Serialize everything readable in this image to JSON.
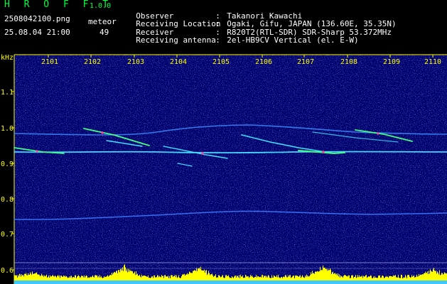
{
  "header": {
    "app_title": "H R O F F T",
    "app_version": "1.0.0",
    "file_name": "2508042100.png",
    "date_time": "25.08.04 21:00",
    "meteor_label": "meteor",
    "meteor_count": "49"
  },
  "info": [
    {
      "key": "Observer",
      "sep": ":",
      "value": "Takanori Kawachi"
    },
    {
      "key": "Receiving Location",
      "sep": ":",
      "value": "Ogaki, Gifu, JAPAN (136.60E, 35.35N)"
    },
    {
      "key": "Receiver",
      "sep": ":",
      "value": "R820T2(RTL-SDR) SDR-Sharp 53.372MHz"
    },
    {
      "key": "Receiving antenna",
      "sep": ":",
      "value": "2el-HB9CV Vertical (el. E-W)"
    }
  ],
  "axes": {
    "y_unit": "kHz",
    "x_ticks": [
      "2101",
      "2102",
      "2103",
      "2104",
      "2105",
      "2106",
      "2107",
      "2108",
      "2109",
      "2110"
    ],
    "y_ticks": [
      "1.1",
      "1.0",
      "0.9",
      "0.8",
      "0.7",
      "0.6"
    ]
  },
  "colors": {
    "background": "#00006a",
    "noise_blue": "#2c3cff",
    "trace_cyan": "#40e0ff",
    "trace_green": "#40ff80",
    "hot_pink": "#ff40a0",
    "signal_yellow": "#ffff00",
    "axis_yellow": "#ffff00",
    "header_green": "#00ff40"
  }
}
